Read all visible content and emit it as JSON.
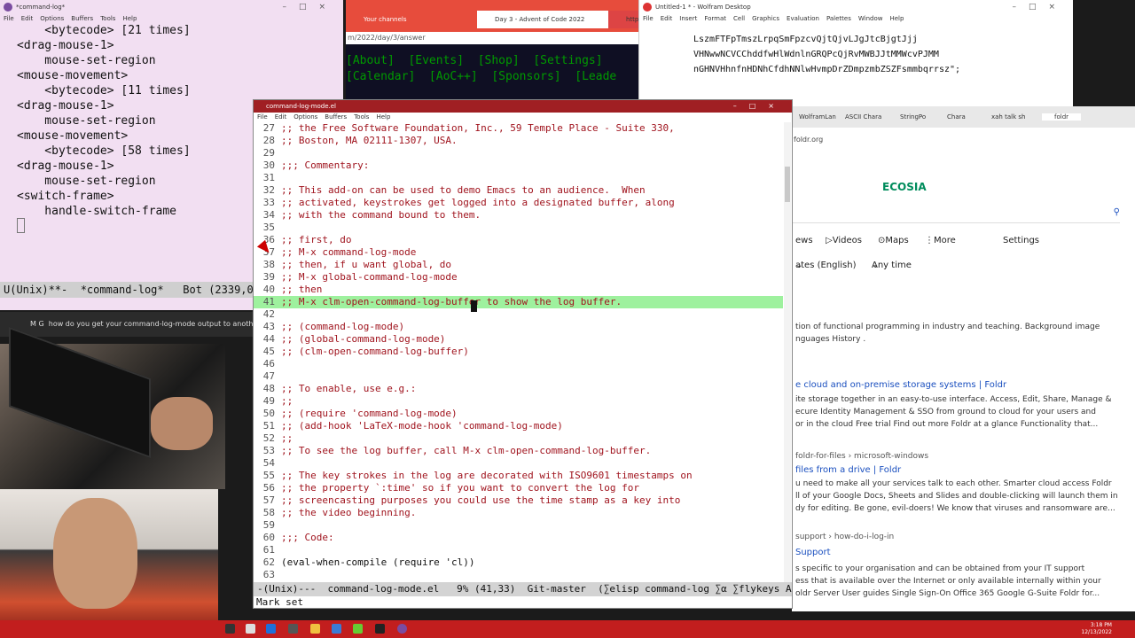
{
  "left_emacs": {
    "title": "*command-log*",
    "menu": [
      "File",
      "Edit",
      "Options",
      "Buffers",
      "Tools",
      "Help"
    ],
    "lines": [
      "    <bytecode> [21 times]",
      "<drag-mouse-1>",
      "    mouse-set-region",
      "<mouse-movement>",
      "    <bytecode> [11 times]",
      "<drag-mouse-1>",
      "    mouse-set-region",
      "<mouse-movement>",
      "    <bytecode> [58 times]",
      "<drag-mouse-1>",
      "    mouse-set-region",
      "<switch-frame>",
      "    handle-switch-frame"
    ],
    "modeline": "U(Unix)**-  *command-log*   Bot (2339,0)  ("
  },
  "chat": {
    "user": "M G",
    "message": "how do you get your command-log-mode output to another w"
  },
  "browser": {
    "tabs": [
      "Your channels",
      "Day 3 - Advent of Code 2022",
      "https"
    ],
    "url": "m/2022/day/3/answer",
    "nav_line1": "[About]  [Events]  [Shop]  [Settings]",
    "nav_line2": "[Calendar]  [AoC++]  [Sponsors]  [Leade"
  },
  "wolfram": {
    "title": "Untitled-1 * - Wolfram Desktop",
    "menu": [
      "File",
      "Edit",
      "Insert",
      "Format",
      "Cell",
      "Graphics",
      "Evaluation",
      "Palettes",
      "Window",
      "Help"
    ],
    "code": [
      "LszmFTFpTmszLrpqSmFpzcvQjtQjvLJgJtcBjgtJjj",
      "VHNwwNCVCChddfwHlWdnlnGRQPcQjRvMWBJJtMMWcvPJMM",
      "nGHNVHhnfnHDNhCfdhNNlwHvmpDrZDmpzmbZSZFsmmbqrrsz\";"
    ]
  },
  "ecosia": {
    "tabs": [
      "WolframLan",
      "ASCII Chara",
      "StringPo",
      "Chara",
      "xah talk sh",
      "foldr"
    ],
    "url": "foldr.org",
    "logo": "ECOSIA",
    "filters": [
      "ews",
      "Videos",
      "Maps",
      "More",
      "Settings"
    ],
    "language": "ates (English)",
    "any_time": "Any time",
    "results": [
      {
        "text": "tion of functional programming in industry and teaching. Background image",
        "kind": "text"
      },
      {
        "text": "nguages History .",
        "kind": "text"
      },
      {
        "text": "e cloud and on-premise storage systems | Foldr",
        "kind": "link"
      },
      {
        "text": "ite storage together in an easy-to-use interface. Access, Edit, Share, Manage &",
        "kind": "text"
      },
      {
        "text": "ecure Identity Management & SSO from ground to cloud for your users and",
        "kind": "text"
      },
      {
        "text": "or in the cloud Free trial Find out more Foldr at a glance Functionality that...",
        "kind": "text"
      },
      {
        "text": "foldr-for-files › microsoft-windows",
        "kind": "path"
      },
      {
        "text": "files from a drive | Foldr",
        "kind": "link"
      },
      {
        "text": "u need to make all your services talk to each other. Smarter cloud access Foldr",
        "kind": "text"
      },
      {
        "text": "ll of your Google Docs, Sheets and Slides and double-clicking will launch them in",
        "kind": "text"
      },
      {
        "text": "dy for editing. Be gone, evil-doers! We know that viruses and ransomware are...",
        "kind": "text"
      },
      {
        "text": "support › how-do-i-log-in",
        "kind": "path"
      },
      {
        "text": "Support",
        "kind": "link"
      },
      {
        "text": "s specific to your organisation and can be obtained from your IT support",
        "kind": "text"
      },
      {
        "text": "ess that is available over the Internet or only available internally within your",
        "kind": "text"
      },
      {
        "text": "oldr Server User guides Single Sign-On Office 365 Google G-Suite Foldr for...",
        "kind": "text"
      }
    ]
  },
  "main_emacs": {
    "title": "command-log-mode.el",
    "menu": [
      "File",
      "Edit",
      "Options",
      "Buffers",
      "Tools",
      "Help"
    ],
    "lines": [
      {
        "n": "27",
        "t": ";; the Free Software Foundation, Inc., 59 Temple Place - Suite 330,"
      },
      {
        "n": "28",
        "t": ";; Boston, MA 02111-1307, USA."
      },
      {
        "n": "29",
        "t": ""
      },
      {
        "n": "30",
        "t": ";;; Commentary:"
      },
      {
        "n": "31",
        "t": ""
      },
      {
        "n": "32",
        "t": ";; This add-on can be used to demo Emacs to an audience.  When"
      },
      {
        "n": "33",
        "t": ";; activated, keystrokes get logged into a designated buffer, along"
      },
      {
        "n": "34",
        "t": ";; with the command bound to them."
      },
      {
        "n": "35",
        "t": ""
      },
      {
        "n": "36",
        "t": ";; first, do"
      },
      {
        "n": "37",
        "t": ";; M-x command-log-mode"
      },
      {
        "n": "38",
        "t": ";; then, if u want global, do"
      },
      {
        "n": "39",
        "t": ";; M-x global-command-log-mode"
      },
      {
        "n": "40",
        "t": ";; then"
      },
      {
        "n": "41",
        "t": ";; M-x clm-open-command-log-buffer to show the log buffer."
      },
      {
        "n": "42",
        "t": ""
      },
      {
        "n": "43",
        "t": ";; (command-log-mode)"
      },
      {
        "n": "44",
        "t": ";; (global-command-log-mode)"
      },
      {
        "n": "45",
        "t": ";; (clm-open-command-log-buffer)"
      },
      {
        "n": "46",
        "t": ""
      },
      {
        "n": "47",
        "t": ""
      },
      {
        "n": "48",
        "t": ";; To enable, use e.g.:"
      },
      {
        "n": "49",
        "t": ";;"
      },
      {
        "n": "50",
        "t": ";; (require 'command-log-mode)"
      },
      {
        "n": "51",
        "t": ";; (add-hook 'LaTeX-mode-hook 'command-log-mode)"
      },
      {
        "n": "52",
        "t": ";;"
      },
      {
        "n": "53",
        "t": ";; To see the log buffer, call M-x clm-open-command-log-buffer."
      },
      {
        "n": "54",
        "t": ""
      },
      {
        "n": "55",
        "t": ";; The key strokes in the log are decorated with ISO9601 timestamps on"
      },
      {
        "n": "56",
        "t": ";; the property `:time' so if you want to convert the log for"
      },
      {
        "n": "57",
        "t": ";; screencasting purposes you could use the time stamp as a key into"
      },
      {
        "n": "58",
        "t": ";; the video beginning."
      },
      {
        "n": "59",
        "t": ""
      },
      {
        "n": "60",
        "t": ";;; Code:"
      },
      {
        "n": "61",
        "t": ""
      },
      {
        "n": "62",
        "t": "(eval-when-compile (require 'cl))"
      },
      {
        "n": "63",
        "t": ""
      }
    ],
    "highlight_line": "41",
    "modeline": "-(Unix)---  command-log-mode.el   9% (41,33)  Git-master  (∑elisp command-log ∑α ∑flykeys Abbrev",
    "minibuffer": "Mark set"
  },
  "taskbar": {
    "time": "3:18 PM",
    "date": "12/13/2022"
  },
  "colors": {
    "emacs_title": "#a01f23",
    "highlight": "#9ef19e",
    "comment": "#a0141e",
    "aoc_green": "#009900",
    "taskbar": "#c21e1e"
  }
}
